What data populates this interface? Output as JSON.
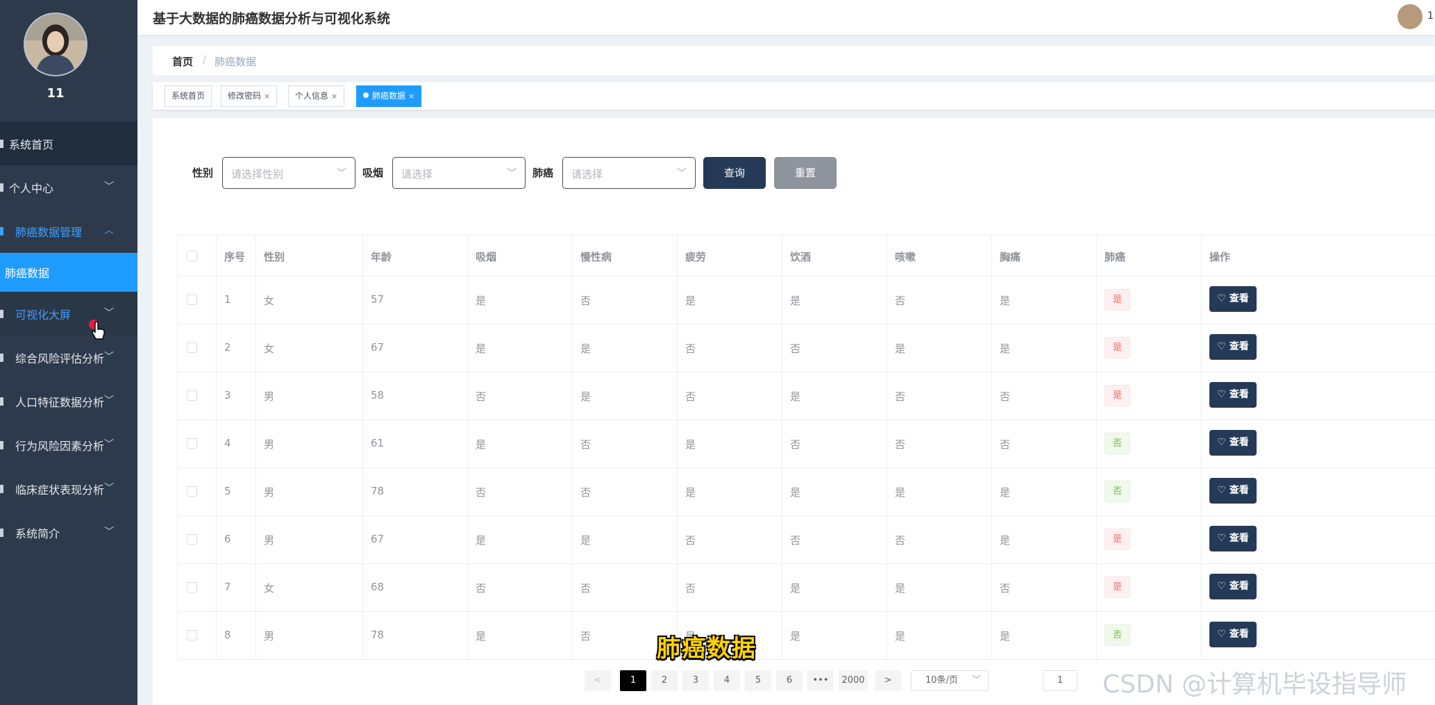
{
  "sidebar": {
    "username": "11",
    "menu": [
      {
        "label": "系统首页",
        "icon": "home-icon"
      },
      {
        "label": "个人中心",
        "icon": "user-icon"
      },
      {
        "label": "肺癌数据管理",
        "icon": "data-icon"
      },
      {
        "label": "肺癌数据",
        "icon": ""
      },
      {
        "label": "可视化大屏",
        "icon": "screen-icon"
      },
      {
        "label": "综合风险评估分析",
        "icon": "chart-icon"
      },
      {
        "label": "人口特征数据分析",
        "icon": "chart-icon"
      },
      {
        "label": "行为风险因素分析",
        "icon": "chart-icon"
      },
      {
        "label": "临床症状表现分析",
        "icon": "chart-icon"
      },
      {
        "label": "系统简介",
        "icon": "info-icon"
      }
    ]
  },
  "header": {
    "title": "基于大数据的肺癌数据分析与可视化系统",
    "user": "1"
  },
  "breadcrumb": {
    "home": "首页",
    "separator": "/",
    "current": "肺癌数据"
  },
  "tabs": [
    {
      "label": "系统首页"
    },
    {
      "label": "修改密码",
      "close": "×"
    },
    {
      "label": "个人信息",
      "close": "×"
    },
    {
      "label": "肺癌数据",
      "close": "×"
    }
  ],
  "filters": {
    "gender_label": "性别",
    "gender_placeholder": "请选择性别",
    "smoke_label": "吸烟",
    "smoke_placeholder": "请选择",
    "cancer_label": "肺癌",
    "cancer_placeholder": "请选择",
    "query_label": "查询",
    "reset_label": "重置"
  },
  "table": {
    "headers": [
      "序号",
      "性别",
      "年龄",
      "吸烟",
      "慢性病",
      "疲劳",
      "饮酒",
      "咳嗽",
      "胸痛",
      "肺癌",
      "操作"
    ],
    "view_label": "查看",
    "rows": [
      [
        "1",
        "女",
        "57",
        "是",
        "否",
        "是",
        "是",
        "否",
        "是",
        "是"
      ],
      [
        "2",
        "女",
        "67",
        "是",
        "是",
        "否",
        "否",
        "是",
        "是",
        "是"
      ],
      [
        "3",
        "男",
        "58",
        "否",
        "是",
        "否",
        "是",
        "否",
        "否",
        "是"
      ],
      [
        "4",
        "男",
        "61",
        "是",
        "否",
        "是",
        "否",
        "否",
        "否",
        "否"
      ],
      [
        "5",
        "男",
        "78",
        "否",
        "否",
        "是",
        "是",
        "是",
        "是",
        "否"
      ],
      [
        "6",
        "男",
        "67",
        "是",
        "是",
        "否",
        "否",
        "否",
        "是",
        "是"
      ],
      [
        "7",
        "女",
        "68",
        "否",
        "否",
        "否",
        "是",
        "是",
        "否",
        "是"
      ],
      [
        "8",
        "男",
        "78",
        "是",
        "否",
        "是",
        "是",
        "是",
        "是",
        "否"
      ]
    ]
  },
  "pagination": {
    "prev": "<",
    "next": ">",
    "pages": [
      "1",
      "2",
      "3",
      "4",
      "5",
      "6"
    ],
    "ellipsis": "•••",
    "last": "2000",
    "page_size": "10条/页",
    "jump_value": "1"
  },
  "overlay": {
    "caption": "肺癌数据",
    "watermark": "CSDN @计算机毕设指导师"
  },
  "colors": {
    "sidebar": "#2d3a4b",
    "accent": "#1e9cff",
    "button": "#253a56"
  }
}
